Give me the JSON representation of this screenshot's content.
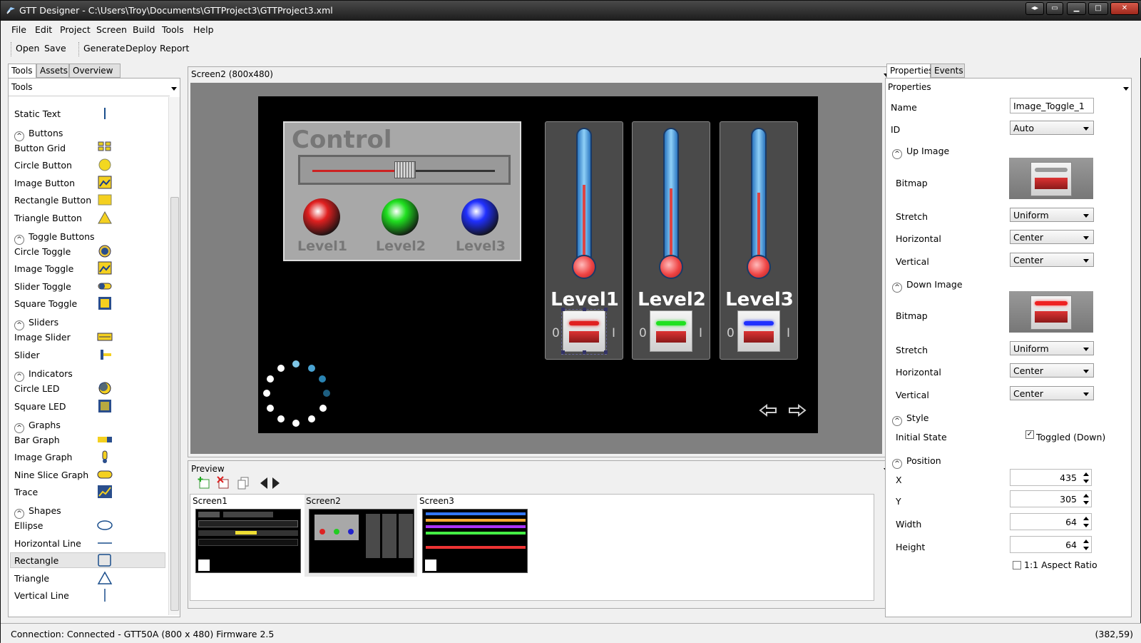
{
  "window": {
    "title": "GTT Designer - C:\\Users\\Troy\\Documents\\GTTProject3\\GTTProject3.xml"
  },
  "menu": [
    "File",
    "Edit",
    "Project",
    "Screen",
    "Build",
    "Tools",
    "Help"
  ],
  "toolbar": {
    "open": "Open",
    "save": "Save",
    "generate": "Generate",
    "deploy": "Deploy",
    "report": "Report"
  },
  "left": {
    "tabs": [
      "Tools",
      "Assets",
      "Overview"
    ],
    "header": "Tools",
    "items": [
      {
        "type": "item",
        "label": "Static Text",
        "icon": "text-cursor-icon"
      },
      {
        "type": "cat",
        "label": "Buttons"
      },
      {
        "type": "item",
        "label": "Button Grid",
        "icon": "button-grid-icon"
      },
      {
        "type": "item",
        "label": "Circle Button",
        "icon": "circle-button-icon"
      },
      {
        "type": "item",
        "label": "Image Button",
        "icon": "image-button-icon"
      },
      {
        "type": "item",
        "label": "Rectangle Button",
        "icon": "rectangle-button-icon"
      },
      {
        "type": "item",
        "label": "Triangle Button",
        "icon": "triangle-button-icon"
      },
      {
        "type": "cat",
        "label": "Toggle Buttons"
      },
      {
        "type": "item",
        "label": "Circle Toggle",
        "icon": "circle-toggle-icon"
      },
      {
        "type": "item",
        "label": "Image Toggle",
        "icon": "image-toggle-icon"
      },
      {
        "type": "item",
        "label": "Slider Toggle",
        "icon": "slider-toggle-icon"
      },
      {
        "type": "item",
        "label": "Square Toggle",
        "icon": "square-toggle-icon"
      },
      {
        "type": "cat",
        "label": "Sliders"
      },
      {
        "type": "item",
        "label": "Image Slider",
        "icon": "image-slider-icon"
      },
      {
        "type": "item",
        "label": "Slider",
        "icon": "slider-icon"
      },
      {
        "type": "cat",
        "label": "Indicators"
      },
      {
        "type": "item",
        "label": "Circle LED",
        "icon": "circle-led-icon"
      },
      {
        "type": "item",
        "label": "Square LED",
        "icon": "square-led-icon"
      },
      {
        "type": "cat",
        "label": "Graphs"
      },
      {
        "type": "item",
        "label": "Bar Graph",
        "icon": "bar-graph-icon"
      },
      {
        "type": "item",
        "label": "Image Graph",
        "icon": "image-graph-icon"
      },
      {
        "type": "item",
        "label": "Nine Slice Graph",
        "icon": "nine-slice-graph-icon"
      },
      {
        "type": "item",
        "label": "Trace",
        "icon": "trace-icon"
      },
      {
        "type": "cat",
        "label": "Shapes"
      },
      {
        "type": "item",
        "label": "Ellipse",
        "icon": "ellipse-icon"
      },
      {
        "type": "item",
        "label": "Horizontal Line",
        "icon": "horizontal-line-icon"
      },
      {
        "type": "item",
        "label": "Rectangle",
        "icon": "rectangle-icon"
      },
      {
        "type": "item",
        "label": "Triangle",
        "icon": "triangle-icon"
      },
      {
        "type": "item",
        "label": "Vertical Line",
        "icon": "vertical-line-icon"
      }
    ]
  },
  "screen": {
    "header": "Screen2 (800x480)",
    "control_title": "Control",
    "levels": [
      "Level1",
      "Level2",
      "Level3"
    ],
    "toggle_zero": "0",
    "toggle_one": "I",
    "level_colors": [
      "#e02020",
      "#20e020",
      "#2030ff"
    ],
    "thermo_fill": [
      0.58,
      0.55,
      0.52
    ],
    "slider_value": 0.5
  },
  "preview": {
    "header": "Preview",
    "screens": [
      "Screen1",
      "Screen2",
      "Screen3"
    ]
  },
  "right": {
    "tabs": [
      "Properties",
      "Events"
    ],
    "header": "Properties",
    "name_label": "Name",
    "name_value": "Image_Toggle_1",
    "id_label": "ID",
    "id_value": "Auto",
    "up_image": "Up Image",
    "down_image": "Down Image",
    "bitmap": "Bitmap",
    "stretch": "Stretch",
    "horizontal": "Horizontal",
    "vertical": "Vertical",
    "stretch_value": "Uniform",
    "center": "Center",
    "style": "Style",
    "initial_state": "Initial State",
    "toggled_down": "Toggled (Down)",
    "position": "Position",
    "x_label": "X",
    "x": "435",
    "y_label": "Y",
    "y": "305",
    "width_label": "Width",
    "width": "64",
    "height_label": "Height",
    "height": "64",
    "aspect": "1:1 Aspect Ratio"
  },
  "status": {
    "connection": "Connection: Connected - GTT50A (800 x 480) Firmware 2.5",
    "coords": "(382,59)"
  }
}
